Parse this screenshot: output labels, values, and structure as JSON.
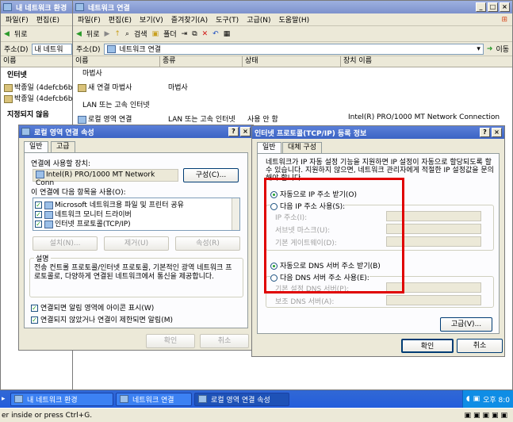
{
  "win_back": {
    "title": "내 네트워크 환경",
    "menu": [
      "파일(F)",
      "편집(E)"
    ],
    "back": "뒤로",
    "addr_label": "주소(D)",
    "addr_value": "내 네트워",
    "col_name": "이름",
    "section_internet": "인터넷",
    "items": [
      "박종일 (4defcb6b3",
      "박종일 (4defcb6b3"
    ],
    "section_unspecified": "지정되지 않음"
  },
  "win_net": {
    "title": "네트워크 연결",
    "menu": [
      "파일(F)",
      "편집(E)",
      "보기(V)",
      "즐겨찾기(A)",
      "도구(T)",
      "고급(N)",
      "도움말(H)"
    ],
    "back": "뒤로",
    "search": "검색",
    "folder": "폴더",
    "addr_label": "주소(D)",
    "addr_value": "네트워크 연결",
    "go": "이동",
    "cols": [
      "이름",
      "종류",
      "상태",
      "장치 이름"
    ],
    "section_wizard": "마법사",
    "wizard_item": "새 연결 마법사",
    "wizard_type": "마법사",
    "section_lan": "LAN 또는 고속 인터넷",
    "lan_item": "로컬 영역 연결",
    "lan_type": "LAN 또는 고속 인터넷",
    "lan_status": "사용 안 함",
    "lan_device": "Intel(R) PRO/1000 MT Network Connection"
  },
  "props": {
    "title": "로컬 영역 연결 속성",
    "tabs": [
      "일반",
      "고급"
    ],
    "connect_using": "연결에 사용할 장치:",
    "device": "Intel(R) PRO/1000 MT Network Conn",
    "configure": "구성(C)...",
    "items_label": "이 연결에 다음 항목을 사용(O):",
    "items": [
      "Microsoft 네트워크용 파일 및 프린터 공유",
      "네트워크 모니터 드라이버",
      "인터넷 프로토콜(TCP/IP)"
    ],
    "install": "설치(N)...",
    "uninstall": "제거(U)",
    "properties": "속성(R)",
    "desc_label": "설명",
    "desc": "전송 컨트롤 프로토콜/인터넷 프로토콜, 기본적인 광역 네트워크 프로토콜로, 다양하게 연결된 네트워크에서 통신을 제공합니다.",
    "chk1": "연결되면 알림 영역에 아이콘 표시(W)",
    "chk2": "연결되지 않았거나 연결이 제한되면 알림(M)",
    "ok": "확인",
    "cancel": "취소"
  },
  "tcpip": {
    "title": "인터넷 프로토콜(TCP/IP) 등록 정보",
    "tabs": [
      "일반",
      "대체 구성"
    ],
    "intro": "네트워크가 IP 자동 설정 기능을 지원하면 IP 설정이 자동으로 할당되도록 할 수 있습니다. 지원하지 않으면, 네트워크 관리자에게 적절한 IP 설정값을 문의해야 합니다.",
    "auto_ip": "자동으로 IP 주소 받기(O)",
    "manual_ip": "다음 IP 주소 사용(S):",
    "ip_addr": "IP 주소(I):",
    "subnet": "서브넷 마스크(U):",
    "gateway": "기본 게이트웨이(D):",
    "auto_dns": "자동으로 DNS 서버 주소 받기(B)",
    "manual_dns": "다음 DNS 서버 주소 사용(E):",
    "pref_dns": "기본 설정 DNS 서버(P):",
    "alt_dns": "보조 DNS 서버(A):",
    "advanced": "고급(V)...",
    "ok": "확인",
    "cancel": "취소"
  },
  "taskbar": {
    "items": [
      "내 네트워크 환경",
      "네트워크 연결",
      "로컬 영역 연결 속성"
    ],
    "clock": "오후 8:0"
  },
  "status": "er inside or press Ctrl+G."
}
